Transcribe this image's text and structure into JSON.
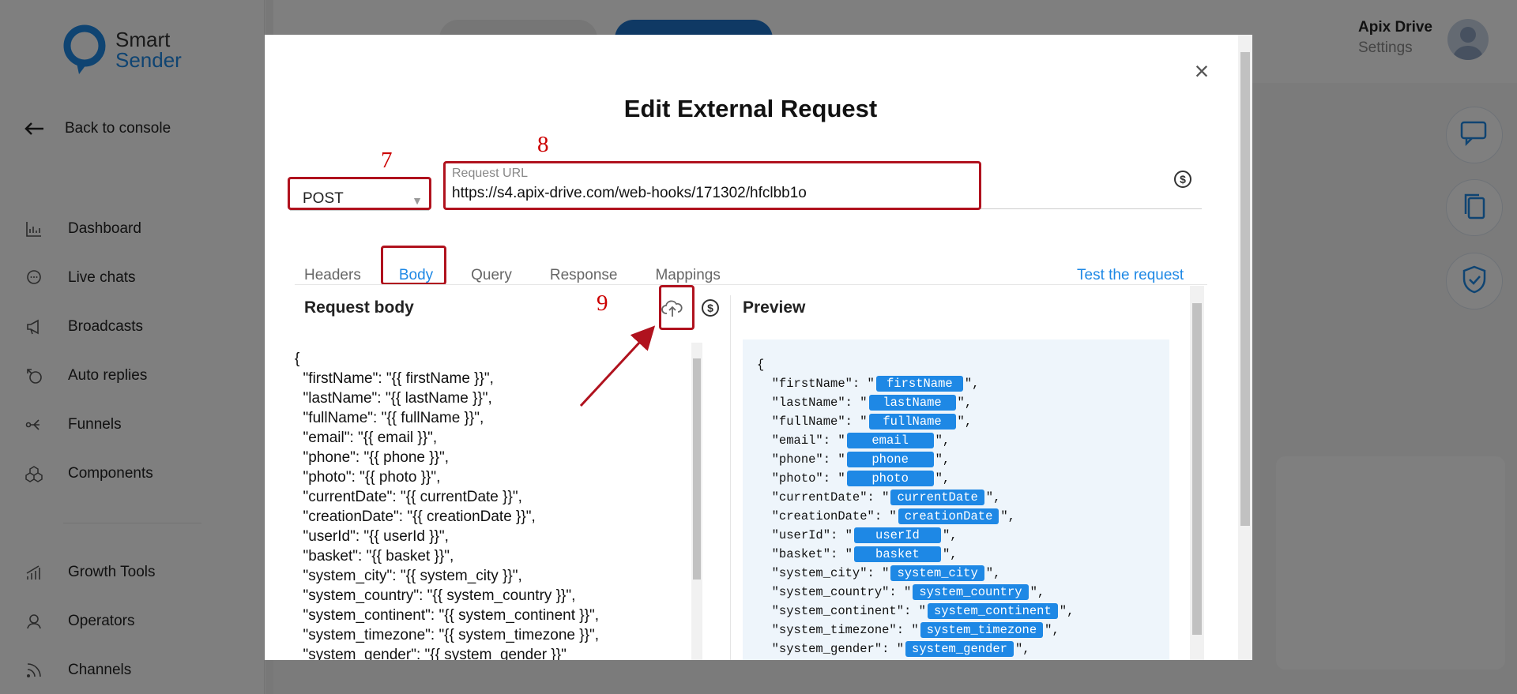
{
  "logo": {
    "line1": "Smart",
    "line2": "Sender"
  },
  "sidebar": {
    "back_label": "Back to console",
    "items": [
      {
        "label": "Dashboard",
        "icon": "chart-icon"
      },
      {
        "label": "Live chats",
        "icon": "chat-bubble-icon"
      },
      {
        "label": "Broadcasts",
        "icon": "megaphone-icon"
      },
      {
        "label": "Auto replies",
        "icon": "auto-reply-icon"
      },
      {
        "label": "Funnels",
        "icon": "funnel-icon"
      },
      {
        "label": "Components",
        "icon": "cubes-icon"
      },
      {
        "label": "Growth Tools",
        "icon": "growth-icon"
      },
      {
        "label": "Operators",
        "icon": "operator-icon"
      },
      {
        "label": "Channels",
        "icon": "rss-icon"
      }
    ]
  },
  "header": {
    "user_name": "Apix Drive",
    "user_sub": "Settings"
  },
  "modal": {
    "title": "Edit External Request",
    "method": "POST",
    "url_label": "Request URL",
    "url_value": "https://s4.apix-drive.com/web-hooks/171302/hfclbb1o",
    "tabs": [
      "Headers",
      "Body",
      "Query",
      "Response",
      "Mappings"
    ],
    "active_tab": "Body",
    "test_label": "Test the request",
    "body_title": "Request body",
    "preview_title": "Preview",
    "annotations": {
      "n7": "7",
      "n8": "8",
      "n9": "9"
    },
    "body_lines": [
      "{",
      "  \"firstName\": \"{{ firstName }}\",",
      "  \"lastName\": \"{{ lastName }}\",",
      "  \"fullName\": \"{{ fullName }}\",",
      "  \"email\": \"{{ email }}\",",
      "  \"phone\": \"{{ phone }}\",",
      "  \"photo\": \"{{ photo }}\",",
      "  \"currentDate\": \"{{ currentDate }}\",",
      "  \"creationDate\": \"{{ creationDate }}\",",
      "  \"userId\": \"{{ userId }}\",",
      "  \"basket\": \"{{ basket }}\",",
      "  \"system_city\": \"{{ system_city }}\",",
      "  \"system_country\": \"{{ system_country }}\",",
      "  \"system_continent\": \"{{ system_continent }}\",",
      "  \"system_timezone\": \"{{ system_timezone }}\",",
      "  \"system_gender\": \"{{ system_gender }}\""
    ],
    "preview_open": "{",
    "preview_lines": [
      {
        "key": "\"firstName\": \"",
        "chip": "firstName"
      },
      {
        "key": "\"lastName\": \"",
        "chip": "lastName"
      },
      {
        "key": "\"fullName\": \"",
        "chip": "fullName"
      },
      {
        "key": "\"email\": \"",
        "chip": "email"
      },
      {
        "key": "\"phone\": \"",
        "chip": "phone"
      },
      {
        "key": "\"photo\": \"",
        "chip": "photo"
      },
      {
        "key": "\"currentDate\": \"",
        "chip": "currentDate"
      },
      {
        "key": "\"creationDate\": \"",
        "chip": "creationDate"
      },
      {
        "key": "\"userId\": \"",
        "chip": "userId"
      },
      {
        "key": "\"basket\": \"",
        "chip": "basket"
      },
      {
        "key": "\"system_city\": \"",
        "chip": "system_city"
      },
      {
        "key": "\"system_country\": \"",
        "chip": "system_country"
      },
      {
        "key": "\"system_continent\": \"",
        "chip": "system_continent"
      },
      {
        "key": "\"system_timezone\": \"",
        "chip": "system_timezone"
      },
      {
        "key": "\"system_gender\": \"",
        "chip": "system_gender"
      }
    ],
    "preview_line_end": "\",",
    "colors": {
      "accent": "#1e88e5",
      "annotation": "#b0121e"
    }
  }
}
